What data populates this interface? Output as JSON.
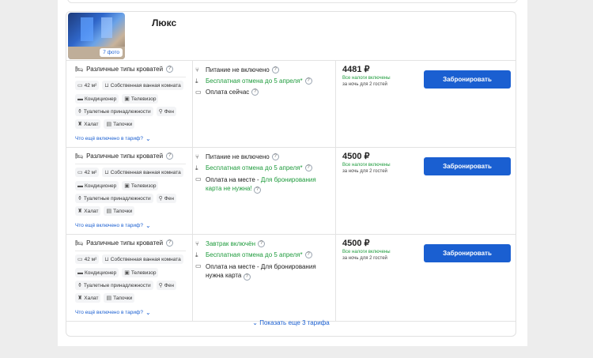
{
  "room": {
    "title": "Люкс",
    "photo_count": "7 фото"
  },
  "rates": [
    {
      "beds": "Различные типы кроватей",
      "area": "42 м²",
      "bathroom": "Собственная ванная комната",
      "ac": "Кондиционер",
      "tv": "Телевизор",
      "toiletries": "Туалетные принадлежности",
      "hairdryer": "Фен",
      "robe": "Халат",
      "slippers": "Тапочки",
      "more_link": "Что ещё включено в тариф?",
      "meal": "Питание не включено",
      "meal_green": false,
      "cancel": "Бесплатная отмена до 5 апреля*",
      "payment": "Оплата сейчас",
      "payment_green": "",
      "payment_tail": "",
      "price": "4481 ₽",
      "taxes": "Все налоги включены",
      "per_night": "за ночь для 2 гостей",
      "book_label": "Забронировать"
    },
    {
      "beds": "Различные типы кроватей",
      "area": "42 м²",
      "bathroom": "Собственная ванная комната",
      "ac": "Кондиционер",
      "tv": "Телевизор",
      "toiletries": "Туалетные принадлежности",
      "hairdryer": "Фен",
      "robe": "Халат",
      "slippers": "Тапочки",
      "more_link": "Что ещё включено в тариф?",
      "meal": "Питание не включено",
      "meal_green": false,
      "cancel": "Бесплатная отмена до 5 апреля*",
      "payment": "Оплата на месте - ",
      "payment_green": "Для бронирования",
      "payment_tail": "карта не нужна!",
      "price": "4500 ₽",
      "taxes": "Все налоги включены",
      "per_night": "за ночь для 2 гостей",
      "book_label": "Забронировать"
    },
    {
      "beds": "Различные типы кроватей",
      "area": "42 м²",
      "bathroom": "Собственная ванная комната",
      "ac": "Кондиционер",
      "tv": "Телевизор",
      "toiletries": "Туалетные принадлежности",
      "hairdryer": "Фен",
      "robe": "Халат",
      "slippers": "Тапочки",
      "more_link": "Что ещё включено в тариф?",
      "meal": "Завтрак включён",
      "meal_green": true,
      "cancel": "Бесплатная отмена до 5 апреля*",
      "payment": "Оплата на месте - Для бронирования",
      "payment_green": "",
      "payment_tail": "нужна карта",
      "price": "4500 ₽",
      "taxes": "Все налоги включены",
      "per_night": "за ночь для 2 гостей",
      "book_label": "Забронировать"
    }
  ],
  "show_more": "Показать еще 3 тарифа",
  "colors": {
    "accent": "#1a5fd1",
    "green": "#1e9b3c"
  },
  "icons": [
    "bed-icon",
    "area-icon",
    "bath-icon",
    "ac-icon",
    "tv-icon",
    "toiletries-icon",
    "hairdryer-icon",
    "robe-icon",
    "slippers-icon",
    "meal-icon",
    "cancel-icon",
    "wallet-icon",
    "chevron-down-icon"
  ]
}
